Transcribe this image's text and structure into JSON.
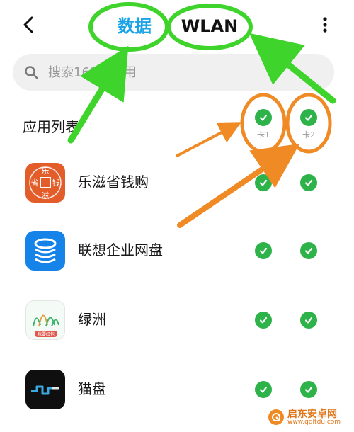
{
  "header": {
    "tab_data": "数据",
    "tab_wlan": "WLAN",
    "back_icon": "back-arrow-icon",
    "more_icon": "more-vertical-icon"
  },
  "search": {
    "placeholder": "搜索162个应用",
    "icon": "search-icon"
  },
  "list": {
    "title": "应用列表",
    "columns": [
      {
        "label": "卡1"
      },
      {
        "label": "卡2"
      }
    ],
    "apps": [
      {
        "name": "乐滋省钱购",
        "icon_text": [
          "乐",
          "省",
          "钱",
          "滋"
        ],
        "sim1": true,
        "sim2": true
      },
      {
        "name": "联想企业网盘",
        "sim1": true,
        "sim2": true
      },
      {
        "name": "绿洲",
        "icon_text": [
          "我要红包"
        ],
        "sim1": true,
        "sim2": true
      },
      {
        "name": "猫盘",
        "sim1": true,
        "sim2": true
      }
    ]
  },
  "watermark": {
    "line1": "启东安卓网",
    "line2": "www.qdltdu.com"
  },
  "colors": {
    "accent_blue": "#1aa3e8",
    "check_green": "#2eb24a",
    "annotation_green": "#3fd42c",
    "annotation_orange": "#f08a24"
  }
}
